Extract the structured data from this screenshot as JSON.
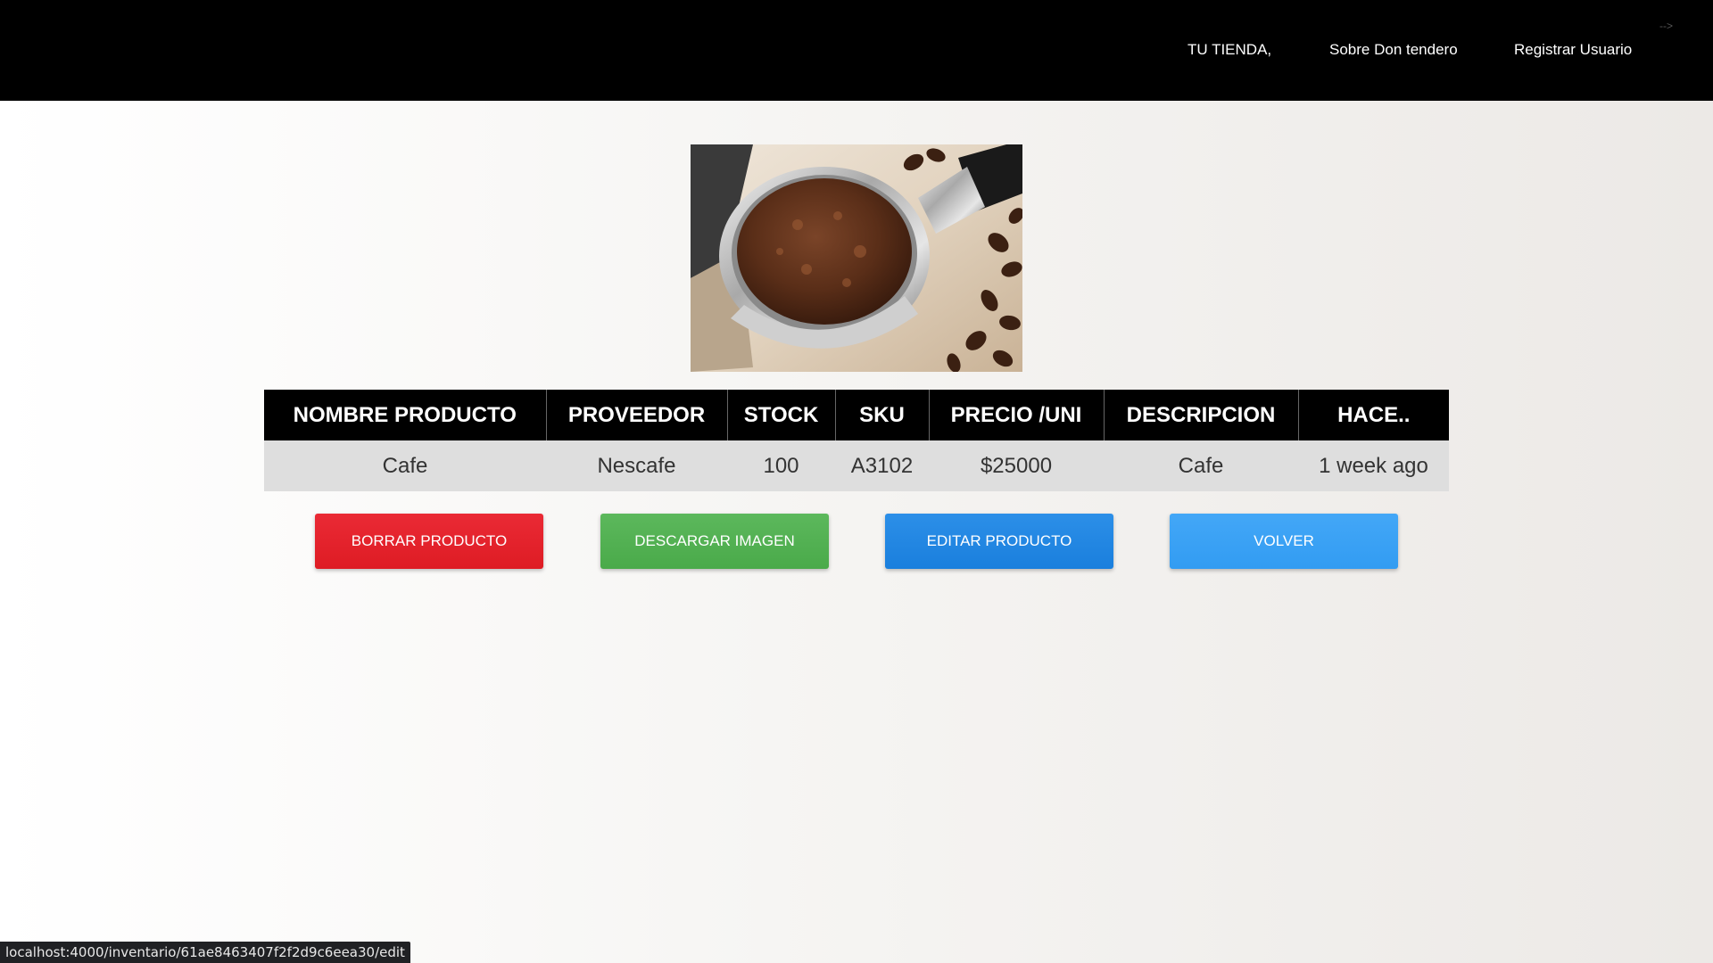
{
  "nav": {
    "links": [
      "TU TIENDA,",
      "Sobre Don tendero",
      "Registrar Usuario"
    ],
    "arrow": "-->"
  },
  "product_image": {
    "icon": "coffee-portafilter-photo"
  },
  "table": {
    "headers": [
      "NOMBRE PRODUCTO",
      "PROVEEDOR",
      "STOCK",
      "SKU",
      "PRECIO /UNI",
      "DESCRIPCION",
      "HACE.."
    ],
    "row": [
      "Cafe",
      "Nescafe",
      "100",
      "A3102",
      "$25000",
      "Cafe",
      "1 week ago"
    ]
  },
  "buttons": {
    "delete": "BORRAR PRODUCTO",
    "download": "DESCARGAR IMAGEN",
    "edit": "EDITAR PRODUCTO",
    "back": "VOLVER"
  },
  "status_bar": {
    "url": "localhost:4000/inventario/61ae8463407f2f2d9c6eea30/edit"
  },
  "colors": {
    "nav_bg": "#000000",
    "delete": "#e3232d",
    "download": "#52b052",
    "edit": "#2287e2",
    "back": "#3aa1f4"
  }
}
